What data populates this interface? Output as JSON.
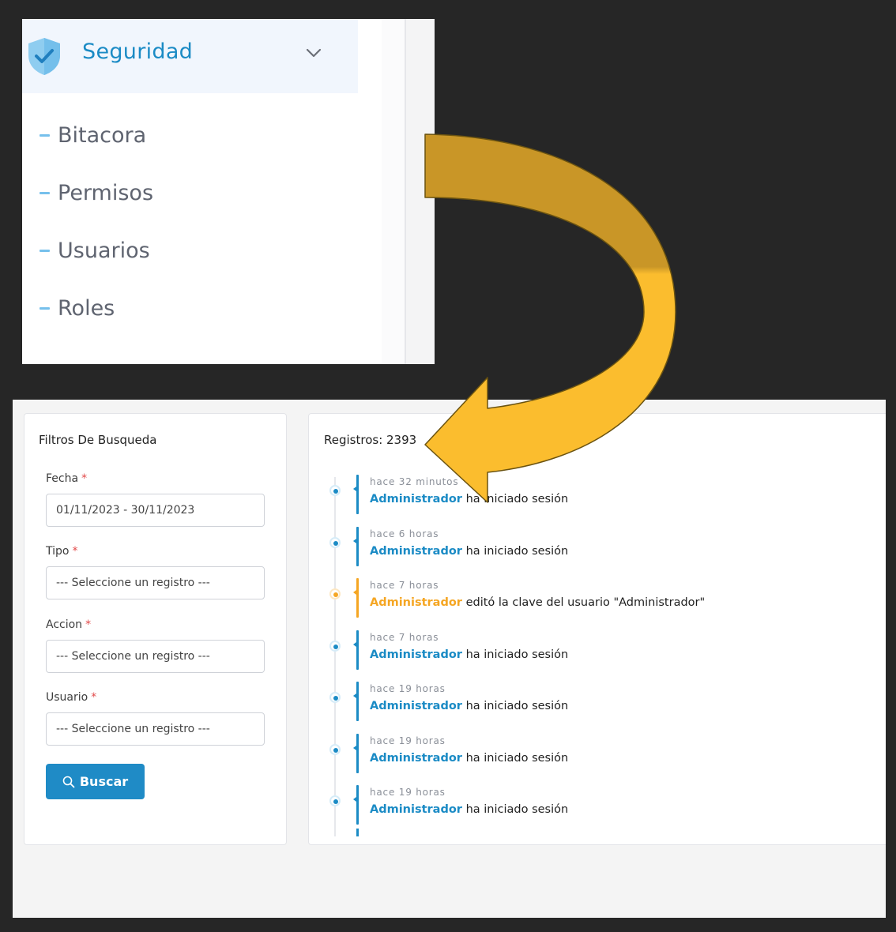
{
  "sidebar": {
    "section_title": "Seguridad",
    "section_icon": "shield-check-icon",
    "expand_icon": "chevron-down-icon",
    "items": [
      {
        "label": "Bitacora"
      },
      {
        "label": "Permisos"
      },
      {
        "label": "Usuarios"
      },
      {
        "label": "Roles"
      }
    ]
  },
  "filters": {
    "title": "Filtros De Busqueda",
    "fields": [
      {
        "label": "Fecha",
        "required_mark": "*",
        "value": "01/11/2023 - 30/11/2023"
      },
      {
        "label": "Tipo",
        "required_mark": "*",
        "value": "--- Seleccione un registro ---"
      },
      {
        "label": "Accion",
        "required_mark": "*",
        "value": "--- Seleccione un registro ---"
      },
      {
        "label": "Usuario",
        "required_mark": "*",
        "value": "--- Seleccione un registro ---"
      }
    ],
    "search_button": "Buscar",
    "search_icon": "search-icon"
  },
  "records": {
    "count_label": "Registros: 2393",
    "entries": [
      {
        "time": "hace 32 minutos",
        "user": "Administrador",
        "action": " ha iniciado sesión",
        "kind": "login"
      },
      {
        "time": "hace 6 horas",
        "user": "Administrador",
        "action": " ha iniciado sesión",
        "kind": "login"
      },
      {
        "time": "hace 7 horas",
        "user": "Administrador",
        "action": " editó la clave del usuario \"Administrador\"",
        "kind": "edit"
      },
      {
        "time": "hace 7 horas",
        "user": "Administrador",
        "action": " ha iniciado sesión",
        "kind": "login"
      },
      {
        "time": "hace 19 horas",
        "user": "Administrador",
        "action": " ha iniciado sesión",
        "kind": "login"
      },
      {
        "time": "hace 19 horas",
        "user": "Administrador",
        "action": " ha iniciado sesión",
        "kind": "login"
      },
      {
        "time": "hace 19 horas",
        "user": "Administrador",
        "action": " ha iniciado sesión",
        "kind": "login"
      }
    ]
  },
  "colors": {
    "primary": "#1b8bc5",
    "edit": "#f5a623",
    "required": "#e24a4a",
    "arrow_top": "#c99627",
    "arrow_bottom": "#fbbd2e"
  }
}
